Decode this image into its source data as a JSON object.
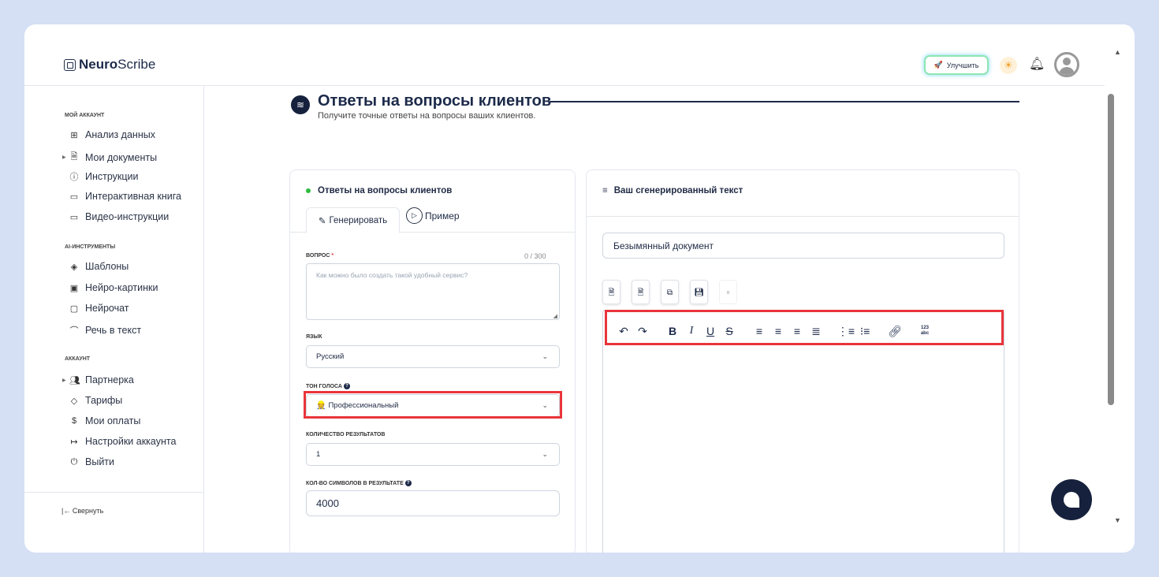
{
  "app": {
    "logo_bold": "Neuro",
    "logo_rest": "Scribe"
  },
  "header": {
    "upgrade_label": "Улучшить"
  },
  "sidebar": {
    "section_account": "МОЙ АККАУНТ",
    "items_account": [
      {
        "label": "Анализ данных",
        "icon": "grid-icon"
      },
      {
        "label": "Мои документы",
        "icon": "document-icon"
      },
      {
        "label": "Инструкции",
        "icon": "help-circle-icon"
      },
      {
        "label": "Интерактивная книга",
        "icon": "book-icon"
      },
      {
        "label": "Видео-инструкции",
        "icon": "video-icon"
      }
    ],
    "section_ai": "AI-ИНСТРУМЕНТЫ",
    "items_ai": [
      {
        "label": "Шаблоны",
        "icon": "layers-icon"
      },
      {
        "label": "Нейро-картинки",
        "icon": "image-icon"
      },
      {
        "label": "Нейрочат",
        "icon": "chat-icon"
      },
      {
        "label": "Речь в текст",
        "icon": "headphones-icon"
      }
    ],
    "section_acc2": "АККАУНТ",
    "items_acc2": [
      {
        "label": "Партнерка",
        "icon": "users-icon"
      },
      {
        "label": "Тарифы",
        "icon": "tag-icon"
      },
      {
        "label": "Мои оплаты",
        "icon": "dollar-icon"
      },
      {
        "label": "Настройки аккаунта",
        "icon": "login-icon"
      },
      {
        "label": "Выйти",
        "icon": "power-icon"
      }
    ],
    "collapse_label": "Свернуть"
  },
  "page": {
    "title": "Ответы на вопросы клиентов",
    "subtitle": "Получите точные ответы на вопросы ваших клиентов."
  },
  "form": {
    "card_title": "Ответы на вопросы клиентов",
    "tab_generate": "Генерировать",
    "tab_example": "Пример",
    "question_label": "ВОПРОС",
    "question_required": "*",
    "question_counter": "0 / 300",
    "question_placeholder": "Как можно было создать такой удобный сервис?",
    "language_label": "ЯЗЫК",
    "language_value": "Русский",
    "tone_label": "ТОН ГОЛОСА",
    "tone_value": "Профессиональный",
    "results_label": "КОЛИЧЕСТВО РЕЗУЛЬТАТОВ",
    "results_value": "1",
    "chars_label": "КОЛ-ВО СИМВОЛОВ В РЕЗУЛЬТАТЕ",
    "chars_value": "4000"
  },
  "output": {
    "card_title": "Ваш сгенерированный текст",
    "doc_name": "Безымянный документ"
  }
}
